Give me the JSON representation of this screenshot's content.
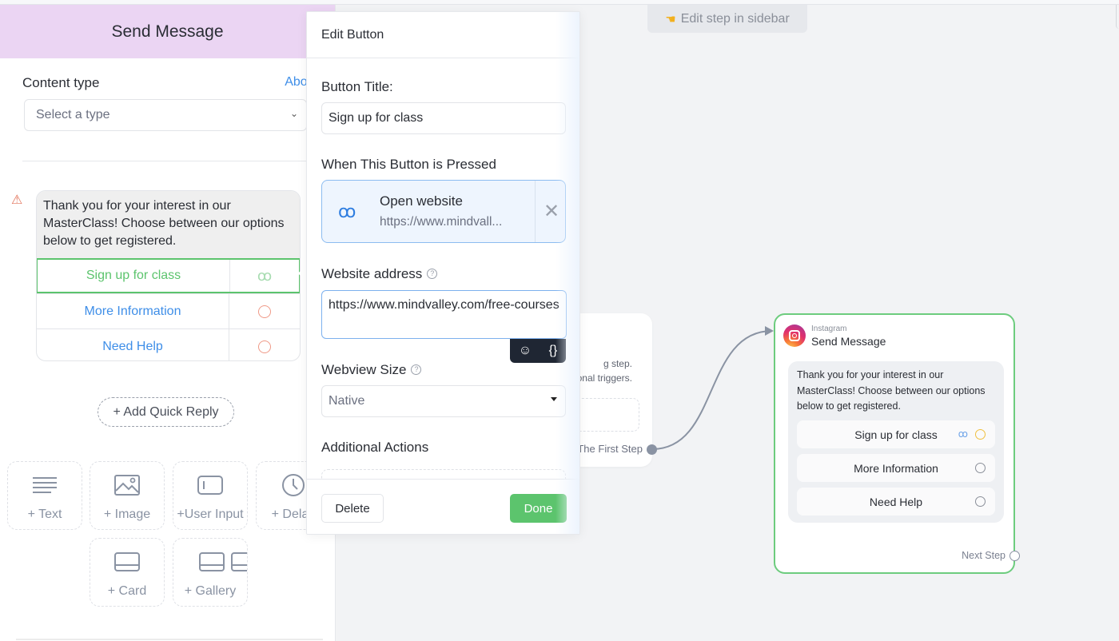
{
  "canvas": {
    "hint": "Edit step in sidebar",
    "hint_icon": "pointing-hand-icon",
    "first_node": {
      "text_lines": [
        "g step.",
        "onal triggers."
      ],
      "output_label": "The First Step"
    },
    "target_node": {
      "platform": "Instagram",
      "title": "Send Message",
      "message": "Thank you for your interest in our MasterClass! Choose between our options below to get registered.",
      "buttons": [
        {
          "label": "Sign up for class",
          "has_link": true
        },
        {
          "label": "More Information",
          "has_link": false
        },
        {
          "label": "Need Help",
          "has_link": false
        }
      ],
      "next_step_label": "Next Step"
    }
  },
  "sidebar": {
    "title": "Send Message",
    "content_type_label": "Content type",
    "about_link": "About",
    "content_type_select": "Select a type",
    "message": "Thank you for your interest in our MasterClass! Choose between our options below to get registered.",
    "buttons": [
      {
        "label": "Sign up for class",
        "selected": true
      },
      {
        "label": "More Information",
        "selected": false
      },
      {
        "label": "Need Help",
        "selected": false
      }
    ],
    "add_quick_reply": "+ Add Quick Reply",
    "tiles": [
      {
        "label": "+ Text",
        "icon": "text-lines-icon"
      },
      {
        "label": "+ Image",
        "icon": "image-icon"
      },
      {
        "label": "+User Input",
        "icon": "user-input-icon"
      },
      {
        "label": "+ Delay",
        "icon": "clock-icon"
      },
      {
        "label": "+ Card",
        "icon": "card-icon"
      },
      {
        "label": "+ Gallery",
        "icon": "gallery-icon"
      }
    ]
  },
  "edit_button": {
    "header": "Edit Button",
    "title_label": "Button Title:",
    "title_value": "Sign up for class",
    "pressed_label": "When This Button is Pressed",
    "action_title": "Open website",
    "action_url": "https://www.mindvall...",
    "website_label": "Website address",
    "website_value": "https://www.mindvalley.com/free-courses",
    "webview_label": "Webview Size",
    "webview_value": "Native",
    "additional_label": "Additional Actions",
    "delete_label": "Delete",
    "done_label": "Done"
  },
  "colors": {
    "accent_green": "#5cc46d",
    "link_blue": "#3e8ee8",
    "header_purple": "#ebd5f3",
    "warning": "#e2735a"
  }
}
